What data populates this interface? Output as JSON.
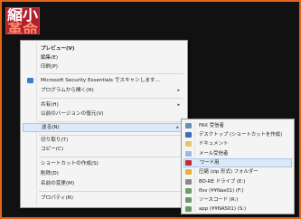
{
  "file_icon": {
    "line1": "縮小",
    "line2": "革命"
  },
  "context_menu": {
    "items": [
      {
        "label": "プレビュー(V)",
        "bold": true
      },
      {
        "label": "編集(E)"
      },
      {
        "label": "印刷(P)"
      },
      {
        "label": "Microsoft Security Essentials でスキャンします..."
      },
      {
        "label": "プログラムから開く(H)",
        "arrow": "▸"
      },
      {
        "label": "共有(H)",
        "arrow": "▸"
      },
      {
        "label": "以前のバージョンの復元(V)"
      },
      {
        "label": "送る(N)",
        "arrow": "▸"
      },
      {
        "label": "切り取り(T)"
      },
      {
        "label": "コピー(C)"
      },
      {
        "label": "ショートカットの作成(S)"
      },
      {
        "label": "削除(D)"
      },
      {
        "label": "名前の変更(M)"
      },
      {
        "label": "プロパティ(R)"
      }
    ]
  },
  "send_to_menu": {
    "items": [
      {
        "label": "FAX 受信者",
        "icon": "fax-icon",
        "color": "#6b8fb5"
      },
      {
        "label": "デスクトップ (ショートカットを作成)",
        "icon": "desktop-icon",
        "color": "#3c6fb0"
      },
      {
        "label": "ドキュメント",
        "icon": "documents-icon",
        "color": "#e4c66a"
      },
      {
        "label": "メール受信者",
        "icon": "mail-icon",
        "color": "#9fb9d6"
      },
      {
        "label": "ワード用",
        "icon": "word-shortcut-icon",
        "color": "#c8283a"
      },
      {
        "label": "圧縮 (zip 形式) フォルダー",
        "icon": "zip-folder-icon",
        "color": "#e0b040"
      },
      {
        "label": "BD-RE ドライブ (E:)",
        "icon": "optical-drive-icon",
        "color": "#8a8a8a"
      },
      {
        "label": "flsv (¥¥Nas01) (F:)",
        "icon": "network-drive-icon",
        "color": "#6a9a6a"
      },
      {
        "label": "ソースコード (R:)",
        "icon": "network-drive-icon",
        "color": "#6a9a6a"
      },
      {
        "label": "app (¥¥NAS01) (S:)",
        "icon": "network-drive-icon",
        "color": "#6a9a6a"
      }
    ]
  }
}
